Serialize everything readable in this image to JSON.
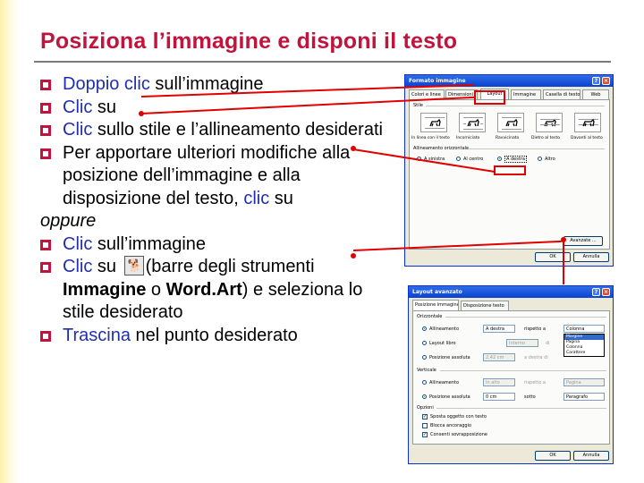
{
  "slide": {
    "title": "Posiziona l’immagine e disponi il testo"
  },
  "bullets": {
    "b1_kw": "Doppio clic",
    "b1_rest": " sull’immagine",
    "b2_kw": "Clic",
    "b2_rest": " su",
    "b3_kw": "Clic",
    "b3_rest": " sullo stile e l’allineamento desiderati",
    "b4_text": "Per apportare ulteriori modifiche alla posizione dell’immagine e alla disposizione del testo, ",
    "b4_kw": "clic",
    "b4_rest": " su",
    "oppure": "oppure",
    "b5_kw": "Clic",
    "b5_rest": " sull’immagine",
    "b6_kw": "Clic",
    "b6_mid": " su ",
    "b6_after": "(barre degli strumenti ",
    "b6_bold1": "Immagine",
    "b6_or": " o ",
    "b6_bold2": "Word.Art",
    "b6_end": ") e seleziona lo stile desiderato",
    "b7_kw": "Trascina",
    "b7_rest": " nel punto desiderato"
  },
  "dialog_format": {
    "title": "Formato immagine",
    "tabs": [
      "Colori e linee",
      "Dimensioni",
      "Layout",
      "Immagine",
      "Casella di testo",
      "Web"
    ],
    "active_tab": "Layout",
    "group_style": "Stile",
    "styles": [
      "In linea con il testo",
      "Incorniciato",
      "Ravvicinato",
      "Dietro al testo",
      "Davanti al testo"
    ],
    "group_align": "Allineamento orizzontale",
    "align_options": [
      "A sinistra",
      "Al centro",
      "A destra",
      "Altro"
    ],
    "selected_align": "A destra",
    "advanced_button": "Avanzate ...",
    "ok_button": "OK",
    "cancel_button": "Annulla"
  },
  "dialog_layout": {
    "title": "Layout avanzato",
    "tabs": [
      "Posizione immagine",
      "Disposizione testo"
    ],
    "active_tab": "Posizione immagine",
    "group_horizontal": "Orizzontale",
    "h_rows": [
      {
        "label": "Allineamento",
        "value": "A destra",
        "rel": "rispetto a",
        "rel_value": "Colonna"
      },
      {
        "label": "Layout libro",
        "value": "Interno",
        "rel": "di",
        "rel_value": "Margine"
      },
      {
        "label": "Posizione assoluta",
        "value": "2,42 cm",
        "rel": "a destra di",
        "rel_value": "Colonna"
      }
    ],
    "dropdown_items": [
      "Margine",
      "Pagina",
      "Colonna",
      "Carattere"
    ],
    "dropdown_selected": "Margine",
    "group_vertical": "Verticale",
    "v_rows": [
      {
        "label": "Allineamento",
        "value": "In alto",
        "rel": "rispetto a",
        "rel_value": "Pagina"
      },
      {
        "label": "Posizione assoluta",
        "value": "0 cm",
        "rel": "sotto",
        "rel_value": "Paragrafo"
      }
    ],
    "group_options": "Opzioni",
    "options": [
      "Sposta oggetto con testo",
      "Blocca ancoraggio",
      "Consenti sovrapposizione"
    ],
    "ok_button": "OK",
    "cancel_button": "Annulla"
  },
  "colors": {
    "title": "#c0143c",
    "keyword": "#1f2fb0",
    "bullet": "#c0143c",
    "callout": "#e00000"
  },
  "icons": {
    "toolbar_icon": "text-wrapping-dog-icon"
  }
}
